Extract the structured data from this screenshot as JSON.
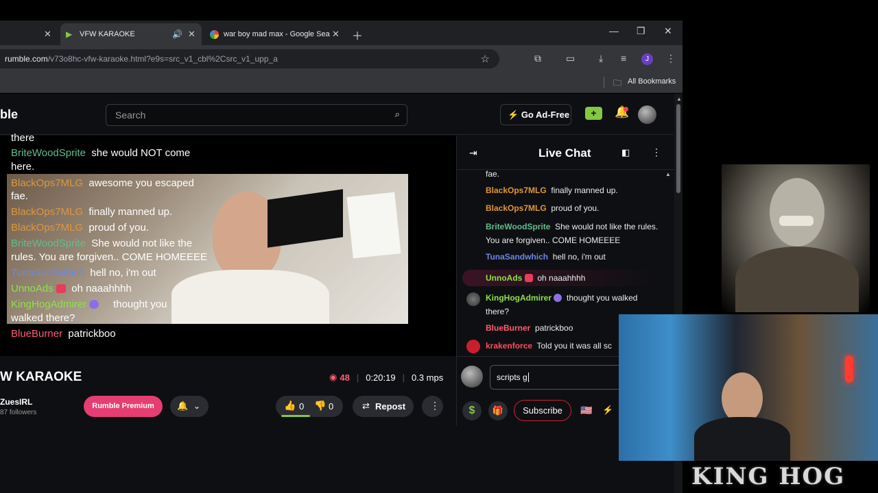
{
  "browser": {
    "tabs": [
      {
        "label": ""
      },
      {
        "label": "VFW KARAOKE"
      },
      {
        "label": "war boy mad max - Google Sea"
      }
    ],
    "url_host": "rumble.com",
    "url_path": "/v73o8hc-vfw-karaoke.html?e9s=src_v1_cbl%2Csrc_v1_upp_a",
    "bookmarks_label": "All Bookmarks",
    "profile_initial": "J"
  },
  "site": {
    "logo_partial": "ble",
    "search_placeholder": "Search",
    "adfree_label": "Go Ad-Free"
  },
  "overlay": {
    "top_partial": "there",
    "line1_user": "BriteWoodSprite",
    "line1_text": "she would NOT come",
    "line1_cont": "here.",
    "lines": [
      {
        "user": "BlackOps7MLG",
        "text": "awesome you escaped"
      },
      {
        "user": "",
        "text": "fae."
      },
      {
        "user": "BlackOps7MLG",
        "text": "finally manned up."
      },
      {
        "user": "BlackOps7MLG",
        "text": "proud of you."
      },
      {
        "user": "BriteWoodSprite",
        "text": "She would not like the"
      },
      {
        "user": "",
        "text": "rules. You are forgiven.. COME HOMEEEE"
      },
      {
        "user": "TunaSandwhich",
        "text": "hell no, i'm out"
      },
      {
        "user": "UnnoAds",
        "text": "oh naaahhhh"
      },
      {
        "user": "KingHogAdmirer",
        "text": "thought you"
      },
      {
        "user": "",
        "text": "walked there?"
      }
    ],
    "bottom_user": "BlueBurner",
    "bottom_text": "patrickboo"
  },
  "video": {
    "title": "W KARAOKE",
    "viewers": "48",
    "duration": "0:20:19",
    "bitrate": "0.3 mps",
    "channel": "ZuesIRL",
    "followers": "87 followers",
    "premium_label": "Rumble Premium",
    "likes": "0",
    "dislikes": "0",
    "repost_label": "Repost"
  },
  "chat": {
    "title": "Live Chat",
    "messages": [
      {
        "user": "",
        "text": "fae."
      },
      {
        "user": "BlackOps7MLG",
        "text": "finally manned up."
      },
      {
        "user": "BlackOps7MLG",
        "text": "proud of you."
      },
      {
        "user": "BriteWoodSprite",
        "text": "She would not like the rules. You are forgiven.. COME HOMEEEE"
      },
      {
        "user": "TunaSandwhich",
        "text": "hell no, i'm out"
      },
      {
        "user": "UnnoAds",
        "text": "oh naaahhhh"
      },
      {
        "user": "KingHogAdmirer",
        "text": "thought you walked there?"
      },
      {
        "user": "BlueBurner",
        "text": "patrickboo"
      },
      {
        "user": "krakenforce",
        "text": "Told you it was all sc"
      }
    ],
    "input_value": "scripts g",
    "subscribe_label": "Subscribe"
  },
  "stream_overlay": {
    "brand": "KING HOG"
  }
}
